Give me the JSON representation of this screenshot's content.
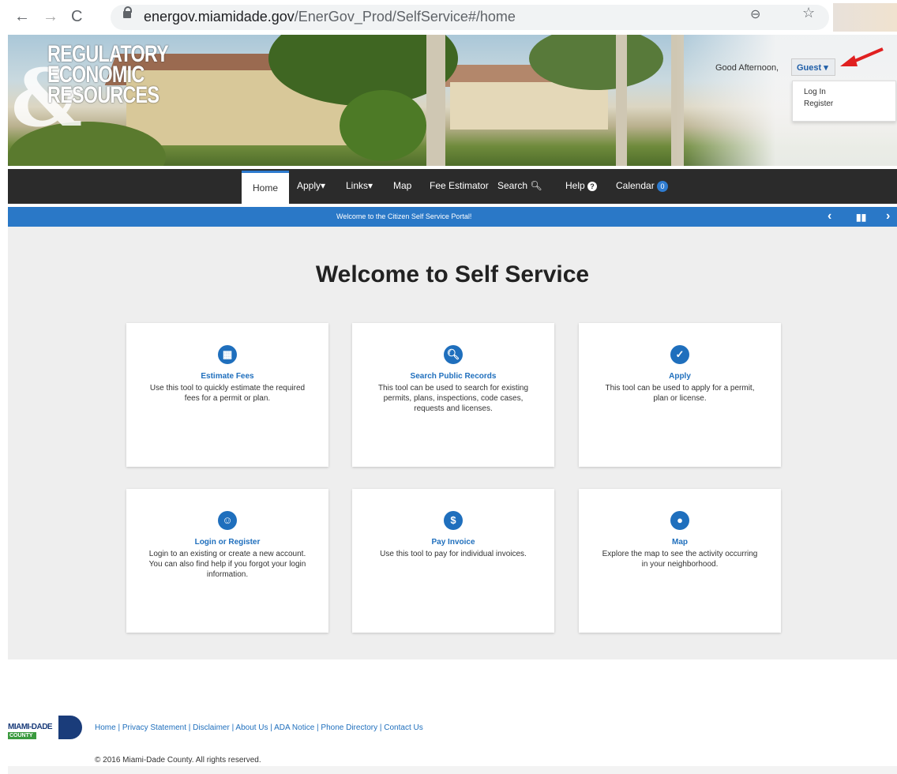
{
  "browser": {
    "url_host": "energov.miamidade.gov",
    "url_path": "/EnerGov_Prod/SelfService#/home"
  },
  "banner": {
    "brand_lines": [
      "REGULATORY",
      "ECONOMIC",
      "RESOURCES"
    ],
    "brand_amp": "&",
    "greeting": "Good Afternoon,",
    "user_label": "Guest",
    "dropdown": [
      "Log In",
      "Register"
    ]
  },
  "nav": {
    "items": [
      "Home",
      "Apply",
      "Links",
      "Map",
      "Fee Estimator",
      "Search",
      "Help",
      "Calendar"
    ],
    "calendar_count": "0"
  },
  "ticker": {
    "text": "Welcome to the Citizen Self Service Portal!"
  },
  "main": {
    "heading": "Welcome to Self Service",
    "cards": [
      {
        "title": "Estimate Fees",
        "desc": "Use this tool to quickly estimate the required fees for a permit or plan.",
        "icon": "calculator-icon"
      },
      {
        "title": "Search Public Records",
        "desc": "This tool can be used to search for existing permits, plans, inspections, code cases, requests and licenses.",
        "icon": "search-icon"
      },
      {
        "title": "Apply",
        "desc": "This tool can be used to apply for a permit, plan or license.",
        "icon": "clipboard-check-icon"
      },
      {
        "title": "Login or Register",
        "desc": "Login to an existing or create a new account. You can also find help if you forgot your login information.",
        "icon": "users-icon"
      },
      {
        "title": "Pay Invoice",
        "desc": "Use this tool to pay for individual invoices.",
        "icon": "dollar-icon"
      },
      {
        "title": "Map",
        "desc": "Explore the map to see the activity occurring in your neighborhood.",
        "icon": "map-marker-icon"
      }
    ]
  },
  "footer": {
    "logo_text": "MIAMI-DADE",
    "logo_county": "COUNTY",
    "links": "Home | Privacy Statement | Disclaimer | About Us | ADA Notice | Phone Directory | Contact Us",
    "copyright": "© 2016 Miami-Dade County. All rights reserved."
  }
}
